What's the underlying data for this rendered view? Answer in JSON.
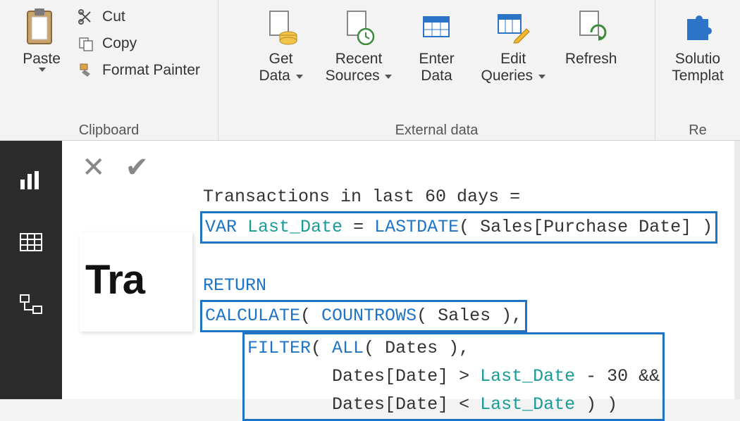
{
  "ribbon": {
    "paste_label": "Paste",
    "cut_label": "Cut",
    "copy_label": "Copy",
    "format_painter_label": "Format Painter",
    "clipboard_group": "Clipboard",
    "get_data_label": "Get\nData",
    "recent_sources_label": "Recent\nSources",
    "enter_data_label": "Enter\nData",
    "edit_queries_label": "Edit\nQueries",
    "refresh_label": "Refresh",
    "solution_templates_label": "Solutio\nTemplat",
    "external_data_group": "External data",
    "resources_group": "Re"
  },
  "formula": {
    "line1_plain": "Transactions in last 60 days = ",
    "var_kw": "VAR",
    "var_name": "Last_Date",
    "eq": " = ",
    "lastdate_fn": "LASTDATE",
    "lastdate_arg": "( Sales[Purchase Date] )",
    "return_kw": "RETURN",
    "calculate_fn": "CALCULATE",
    "countrows_fn": "COUNTROWS",
    "calc_line": "( Sales ),",
    "filter_fn": "FILTER",
    "all_fn": "ALL",
    "filter_head": "( Dates ),",
    "dates_gt": "Dates[Date] > ",
    "lastdate_ref": "Last_Date",
    "minus30": " - 30 &&",
    "dates_lt": "Dates[Date] < ",
    "closing": " ) )"
  },
  "preview": {
    "title_fragment": "Tra"
  }
}
